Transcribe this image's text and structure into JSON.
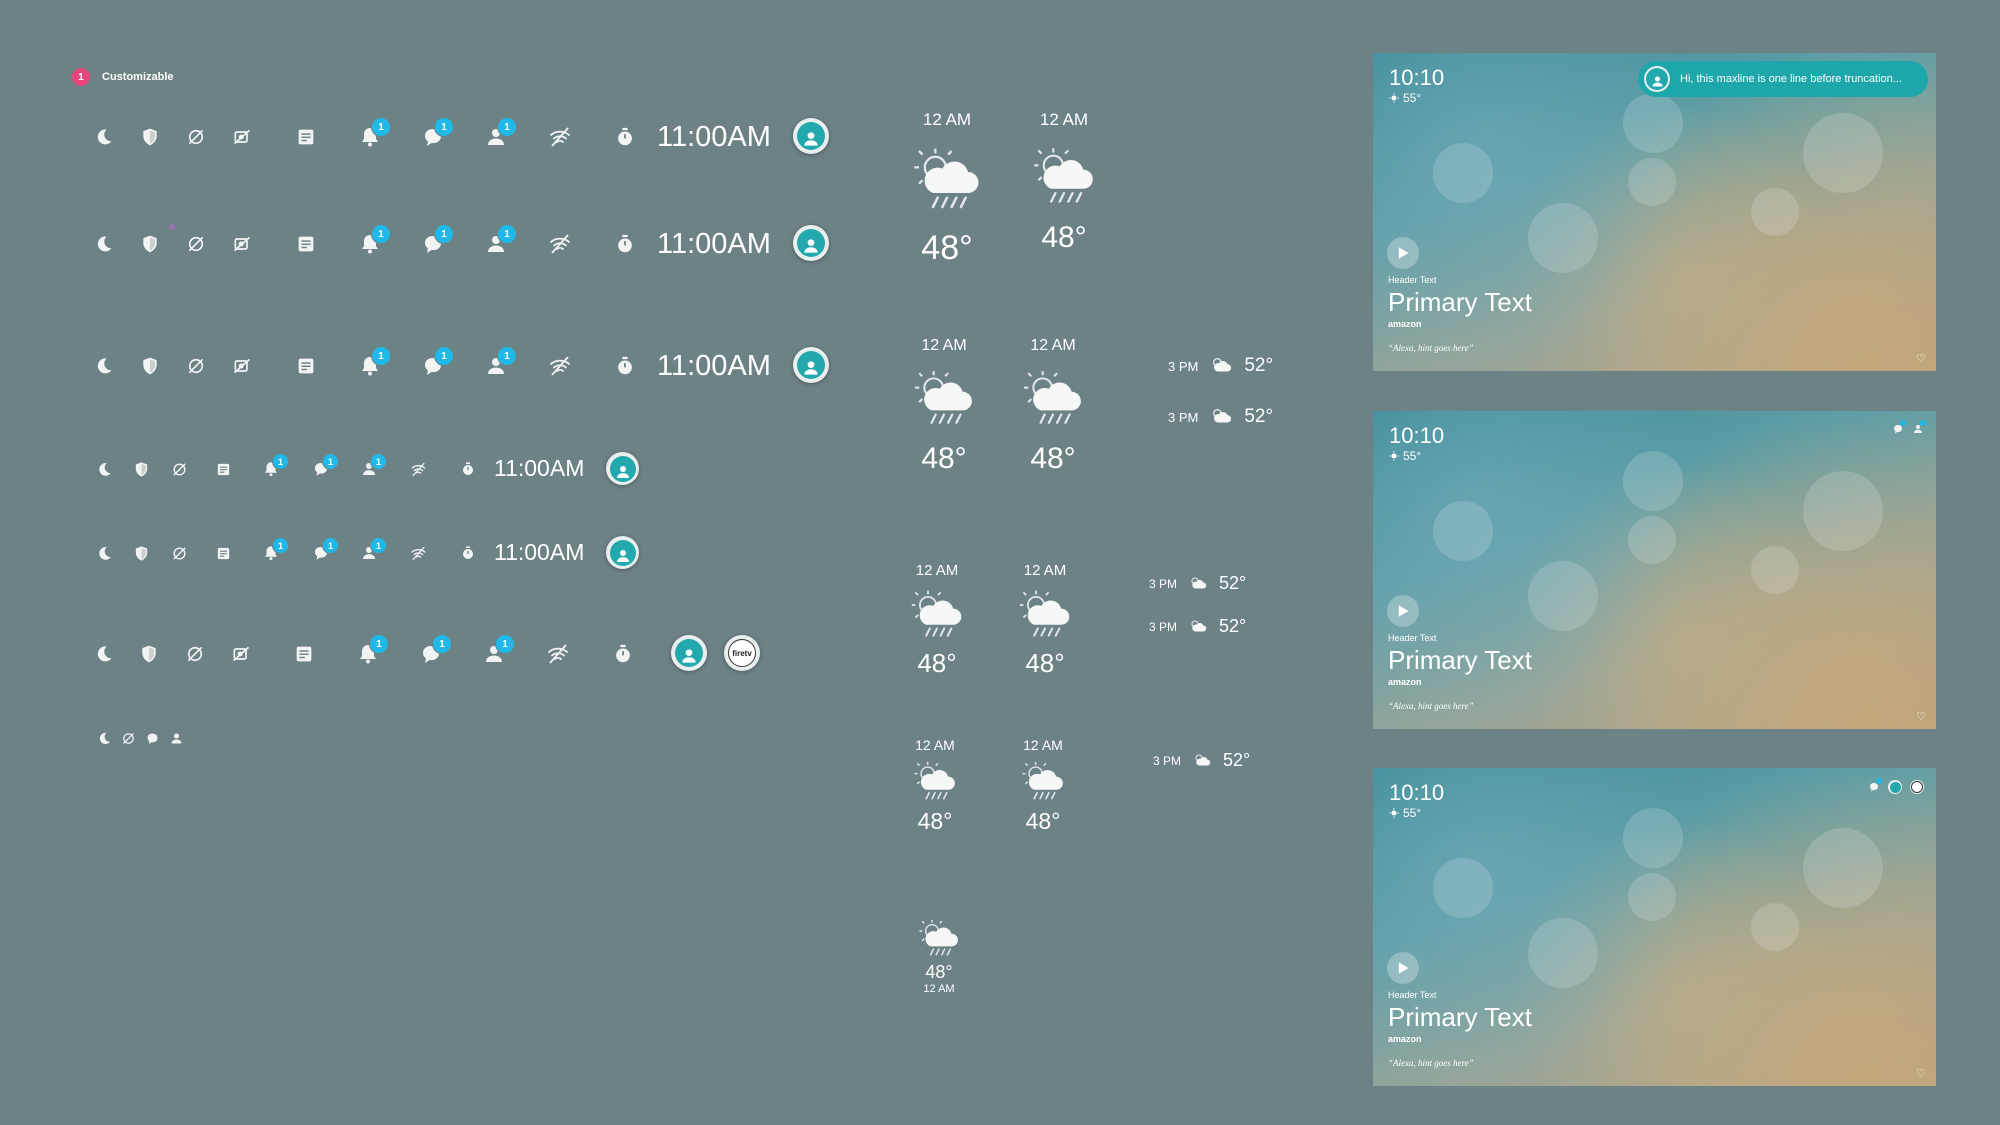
{
  "legend": {
    "number": "1",
    "label": "Customizable"
  },
  "status_bar": {
    "clock": "11:00AM",
    "badge_count": "1",
    "firetv_label": "firetv",
    "colors": {
      "badge": "#1fb8e8",
      "avatar": "#23a9ad",
      "legend": "#e5457b"
    }
  },
  "weather": {
    "time": "12 AM",
    "temp": "48°",
    "hourly_time": "3 PM",
    "hourly_temp": "52°"
  },
  "screens": {
    "time": "10:10",
    "temp": "55°",
    "header_text": "Header Text",
    "primary_text": "Primary Text",
    "brand": "amazon",
    "hint": "“Alexa, hint goes here”",
    "toast_text": "Hi, this maxline is one line before truncation..."
  }
}
